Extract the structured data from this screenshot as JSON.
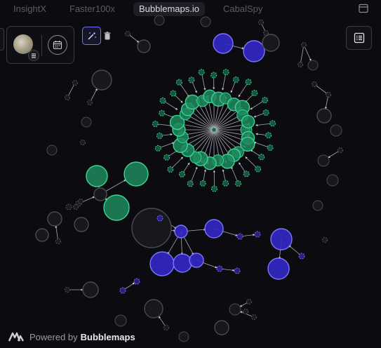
{
  "tabs": [
    {
      "label": "InsightX",
      "active": false
    },
    {
      "label": "Faster100x",
      "active": false
    },
    {
      "label": "Bubblemaps.io",
      "active": true
    },
    {
      "label": "CabalSpy",
      "active": false
    }
  ],
  "footer": {
    "prefix": "Powered by",
    "brand": "Bubblemaps"
  },
  "colors": {
    "background": "#0c0c10",
    "green_bubble": "#1f8a5e",
    "green_stroke": "#3ad492",
    "purple_bubble": "#3328c8",
    "purple_stroke": "#7d74ff",
    "gray_bubble": "#17171c",
    "gray_stroke": "#4a4a52",
    "accent": "#7a72ff"
  },
  "icons": [
    "window-icon",
    "avatar",
    "calendar-icon",
    "magic-wand-icon",
    "trash-icon",
    "list-icon",
    "bubblemaps-logo-icon"
  ]
}
